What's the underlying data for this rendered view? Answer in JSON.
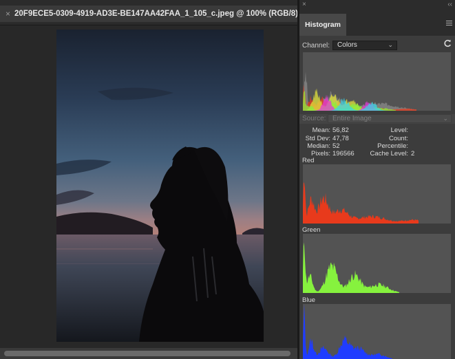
{
  "document": {
    "tab_title": "20F9ECE5-0309-4919-AD3E-BE147AA42FAA_1_105_c.jpeg @ 100% (RGB/8) *",
    "close_glyph": "×"
  },
  "panel": {
    "close_glyph": "×",
    "collapse_glyph": "‹‹",
    "tab": "Histogram",
    "menu_icon": "hamburger-menu-icon",
    "channel_label": "Channel:",
    "channel_value": "Colors",
    "channel_chevron": "⌄",
    "refresh_icon": "refresh-icon",
    "warning_icon": "cache-warning-icon",
    "source_label": "Source:",
    "source_value": "Entire Image",
    "stats": {
      "mean_label": "Mean:",
      "mean": "56,82",
      "stddev_label": "Std Dev:",
      "stddev": "47,78",
      "median_label": "Median:",
      "median": "52",
      "pixels_label": "Pixels:",
      "pixels": "196566",
      "level_label": "Level:",
      "level": "",
      "count_label": "Count:",
      "count": "",
      "percentile_label": "Percentile:",
      "percentile": "",
      "cache_label": "Cache Level:",
      "cache": "2"
    },
    "channels": {
      "red": "Red",
      "green": "Green",
      "blue": "Blue"
    }
  },
  "colors": {
    "red_hist": "#e83a1c",
    "green_hist": "#86f23e",
    "blue_hist": "#1f3cff",
    "panel_bg": "#3c3c3c",
    "hist_bg": "#535353"
  }
}
